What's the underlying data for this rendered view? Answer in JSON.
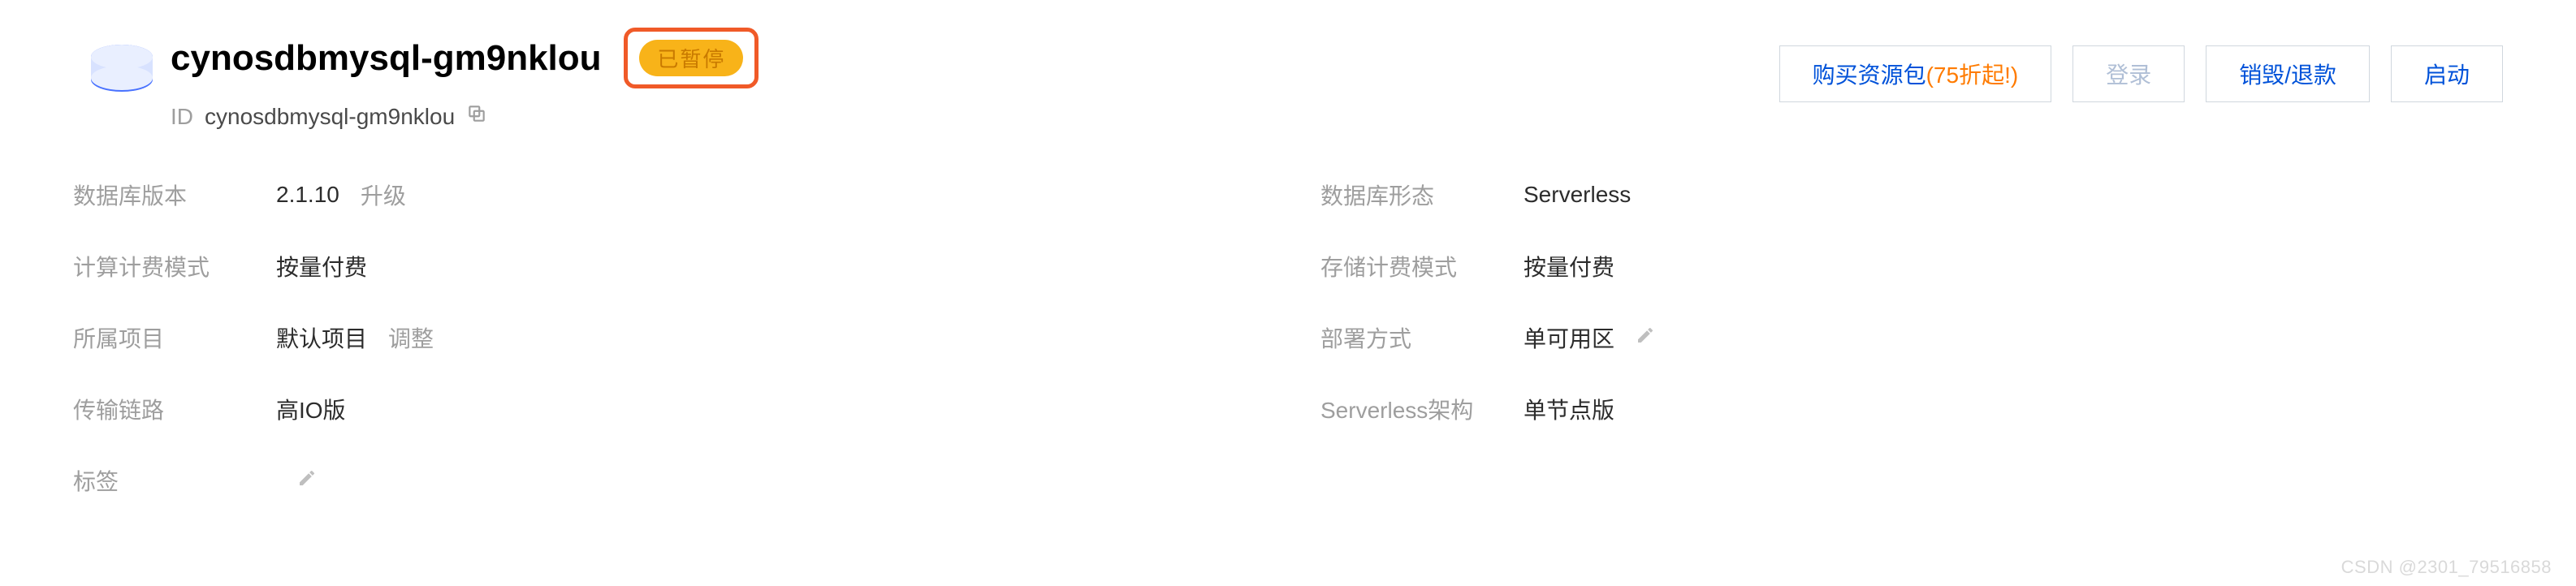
{
  "header": {
    "cluster_name": "cynosdbmysql-gm9nklou",
    "status_label": "已暂停",
    "id_label": "ID",
    "id_value": "cynosdbmysql-gm9nklou"
  },
  "actions": {
    "buy_pkg_prefix": "购买资源包",
    "buy_pkg_discount": "(75折起!)",
    "login": "登录",
    "destroy": "销毁/退款",
    "start": "启动"
  },
  "left": {
    "db_version": {
      "label": "数据库版本",
      "value": "2.1.10",
      "link": "升级"
    },
    "billing_compute": {
      "label": "计算计费模式",
      "value": "按量付费"
    },
    "project": {
      "label": "所属项目",
      "value": "默认项目",
      "link": "调整"
    },
    "transport": {
      "label": "传输链路",
      "value": "高IO版"
    },
    "tags": {
      "label": "标签",
      "value": ""
    }
  },
  "right": {
    "db_form": {
      "label": "数据库形态",
      "value": "Serverless"
    },
    "billing_storage": {
      "label": "存储计费模式",
      "value": "按量付费"
    },
    "deploy": {
      "label": "部署方式",
      "value": "单可用区"
    },
    "sl_arch": {
      "label": "Serverless架构",
      "value": "单节点版"
    }
  },
  "watermark": "CSDN @2301_79516858"
}
